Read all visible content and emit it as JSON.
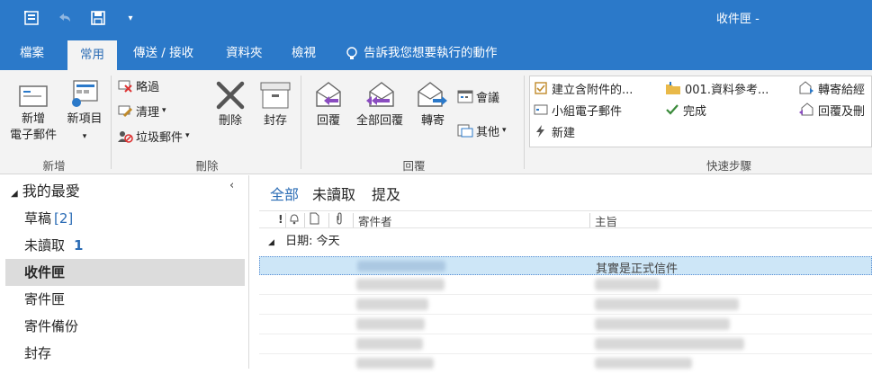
{
  "window": {
    "title": "收件匣 -"
  },
  "quick_access": {
    "icons": [
      "send-receive-icon",
      "undo-icon",
      "save-icon",
      "customize-dropdown-icon"
    ],
    "customize_glyph": "▾"
  },
  "tabs": [
    {
      "label": "檔案"
    },
    {
      "label": "常用"
    },
    {
      "label": "傳送 / 接收"
    },
    {
      "label": "資料夾"
    },
    {
      "label": "檢視"
    }
  ],
  "tell_me": {
    "label": "告訴我您想要執行的動作"
  },
  "ribbon": {
    "new_group": {
      "label": "新增",
      "new_email": {
        "line1": "新增",
        "line2": "電子郵件"
      },
      "new_items": {
        "line1": "新項目",
        "arrow": "▾"
      }
    },
    "delete_group": {
      "label": "刪除",
      "ignore": "略過",
      "clean_up": "清理",
      "junk": "垃圾郵件",
      "delete": "刪除",
      "archive": "封存",
      "arrow": "▾"
    },
    "respond_group": {
      "label": "回覆",
      "reply": "回覆",
      "reply_all": "全部回覆",
      "forward": "轉寄",
      "meeting": "會議",
      "more": "其他",
      "arrow": "▾"
    },
    "quick_steps_group": {
      "label": "快速步驟",
      "items": [
        {
          "label": "建立含附件的..."
        },
        {
          "label": "001.資料參考..."
        },
        {
          "label": "轉寄給經"
        },
        {
          "label": "小組電子郵件"
        },
        {
          "label": "完成"
        },
        {
          "label": "回覆及刪"
        },
        {
          "label": "新建"
        }
      ]
    }
  },
  "nav": {
    "favorites_label": "我的最愛",
    "collapse_glyph": "‹",
    "expand_glyph": "◢",
    "items": [
      {
        "label": "草稿",
        "count": "[2]"
      },
      {
        "label": "未讀取",
        "count": "1"
      },
      {
        "label": "收件匣",
        "count": ""
      },
      {
        "label": "寄件匣",
        "count": ""
      },
      {
        "label": "寄件備份",
        "count": ""
      },
      {
        "label": "封存",
        "count": ""
      }
    ]
  },
  "message_list": {
    "filters": [
      "全部",
      "未讀取",
      "提及"
    ],
    "columns": {
      "importance": "!",
      "from": "寄件者",
      "subject": "主旨"
    },
    "group_header": "日期: 今天",
    "group_glyph": "◢",
    "selected_subject": "其實是正式信件"
  },
  "colors": {
    "accent": "#2b79c9",
    "selected_row": "#cde6f7",
    "selected_nav": "#dcdcdc"
  }
}
